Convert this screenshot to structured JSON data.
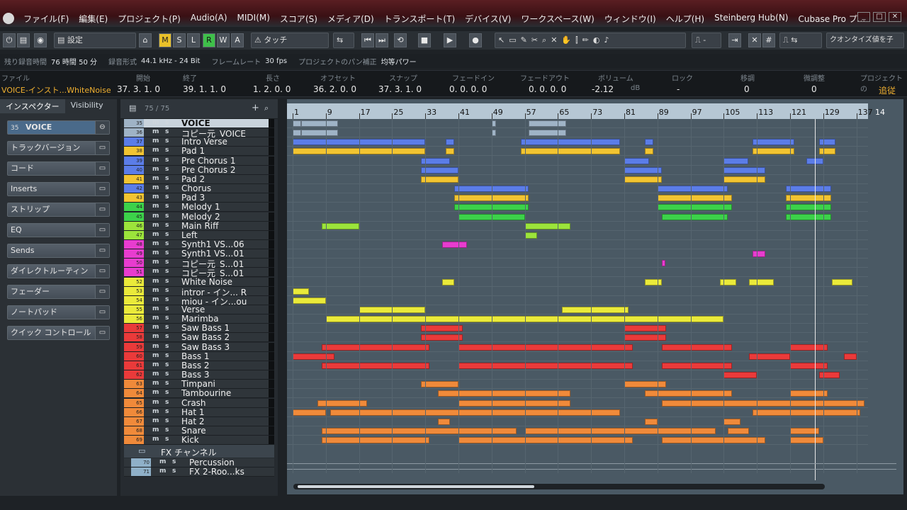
{
  "menubar": {
    "items": [
      "ファイル(F)",
      "編集(E)",
      "プロジェクト(P)",
      "Audio(A)",
      "MIDI(M)",
      "スコア(S)",
      "メディア(D)",
      "トランスポート(T)",
      "デバイス(V)",
      "ワークスペース(W)",
      "ウィンドウ(I)",
      "ヘルプ(H)",
      "Steinberg Hub(N)",
      "Cubase Pro プ..."
    ]
  },
  "toolbar": {
    "setting": "設定",
    "m": "M",
    "s": "S",
    "l": "L",
    "r": "R",
    "w": "W",
    "a": "A",
    "touch": "タッチ",
    "quantize": "クオンタイズ値を子"
  },
  "status": {
    "rec_time_label": "残り録音時間",
    "rec_time_value": "76 時間 50 分",
    "format_label": "録音形式",
    "format_value": "44.1 kHz - 24 Bit",
    "frame_label": "フレームレート",
    "frame_value": "30 fps",
    "pan_label": "プロジェクトのパン補正",
    "pan_value": "均等パワー"
  },
  "infoline": {
    "headers": [
      "ファイル",
      "開始",
      "終了",
      "長さ",
      "オフセット",
      "スナップ",
      "フェードイン",
      "フェードアウト",
      "ボリューム",
      "ロック",
      "移調",
      "微調整",
      "プロジェクトの"
    ],
    "values": [
      "VOICE-インスト...WhiteNoise",
      "37. 3. 1.   0",
      "39. 1. 1.   0",
      "1. 2. 0.   0",
      "36. 2. 0.   0",
      "37. 3. 1.   0",
      "0. 0. 0.   0",
      "0. 0. 0.   0",
      "-2.12",
      "-",
      "0",
      "0",
      "追従"
    ],
    "volume_unit": "dB"
  },
  "inspector": {
    "tabs": [
      "インスペクター",
      "Visibility"
    ],
    "track_number": "35",
    "track_name": "VOICE",
    "sections": [
      "トラックバージョン",
      "コード",
      "Inserts",
      "ストリップ",
      "EQ",
      "Sends",
      "ダイレクトルーティン",
      "フェーダー",
      "ノートパッド",
      "クイック コントロール"
    ]
  },
  "tracklist": {
    "count": "75 / 75",
    "tracks": [
      {
        "num": "35",
        "name": "VOICE",
        "color": "#9fb3c6"
      },
      {
        "num": "36",
        "name": "コピー元_VOICE",
        "color": "#9fb3c6"
      },
      {
        "num": "37",
        "name": "Intro Verse",
        "color": "#5b7de8"
      },
      {
        "num": "38",
        "name": "Pad 1",
        "color": "#f2c431"
      },
      {
        "num": "39",
        "name": "Pre Chorus 1",
        "color": "#5b7de8"
      },
      {
        "num": "40",
        "name": "Pre Chorus 2",
        "color": "#5b7de8"
      },
      {
        "num": "41",
        "name": "Pad 2",
        "color": "#f2c431"
      },
      {
        "num": "42",
        "name": "Chorus",
        "color": "#5b7de8"
      },
      {
        "num": "43",
        "name": "Pad 3",
        "color": "#f2c431"
      },
      {
        "num": "44",
        "name": "Melody 1",
        "color": "#3cd24a"
      },
      {
        "num": "45",
        "name": "Melody 2",
        "color": "#3cd24a"
      },
      {
        "num": "46",
        "name": "Main Riff",
        "color": "#9ce43b"
      },
      {
        "num": "47",
        "name": "Left",
        "color": "#9ce43b"
      },
      {
        "num": "48",
        "name": "Synth1 VS...06",
        "color": "#e83ccf"
      },
      {
        "num": "49",
        "name": "Synth1 VS...01",
        "color": "#e83ccf"
      },
      {
        "num": "50",
        "name": "コピー元_S...01",
        "color": "#e83ccf"
      },
      {
        "num": "51",
        "name": "コピー元_S...01",
        "color": "#e83ccf"
      },
      {
        "num": "52",
        "name": "White Noise",
        "color": "#eaea3a"
      },
      {
        "num": "53",
        "name": "intror - イン... R",
        "color": "#eaea3a"
      },
      {
        "num": "54",
        "name": "miou - イン...ou",
        "color": "#eaea3a"
      },
      {
        "num": "55",
        "name": "Verse",
        "color": "#eaea3a"
      },
      {
        "num": "56",
        "name": "Marimba",
        "color": "#eaea3a"
      },
      {
        "num": "57",
        "name": "Saw Bass 1",
        "color": "#ea3a3a"
      },
      {
        "num": "58",
        "name": "Saw Bass 2",
        "color": "#ea3a3a"
      },
      {
        "num": "59",
        "name": "Saw Bass 3",
        "color": "#ea3a3a"
      },
      {
        "num": "60",
        "name": "Bass 1",
        "color": "#ea3a3a"
      },
      {
        "num": "61",
        "name": "Bass 2",
        "color": "#ea3a3a"
      },
      {
        "num": "62",
        "name": "Bass 3",
        "color": "#ea3a3a"
      },
      {
        "num": "63",
        "name": "Timpani",
        "color": "#f08a3a"
      },
      {
        "num": "64",
        "name": "Tambourine",
        "color": "#f08a3a"
      },
      {
        "num": "65",
        "name": "Crash",
        "color": "#f08a3a"
      },
      {
        "num": "66",
        "name": "Hat 1",
        "color": "#f08a3a"
      },
      {
        "num": "67",
        "name": "Hat 2",
        "color": "#f08a3a"
      },
      {
        "num": "68",
        "name": "Snare",
        "color": "#f08a3a"
      },
      {
        "num": "69",
        "name": "Kick",
        "color": "#f08a3a"
      }
    ],
    "folder": "FX チャンネル",
    "fx_tracks": [
      {
        "num": "70",
        "name": "Percussion"
      },
      {
        "num": "71",
        "name": "FX 2-Roo...ks"
      }
    ],
    "m": "m",
    "s": "s"
  },
  "ruler": {
    "bars": [
      "1",
      "9",
      "17",
      "25",
      "33",
      "41",
      "49",
      "57",
      "65",
      "73",
      "81",
      "89",
      "97",
      "105",
      "113",
      "121",
      "129",
      "137"
    ],
    "overflow": "14"
  },
  "events": [
    [
      [
        1,
        2
      ],
      [
        3,
        9
      ],
      [
        49,
        1
      ],
      [
        58,
        9
      ]
    ],
    [
      [
        1,
        2
      ],
      [
        3,
        9
      ],
      [
        49,
        1
      ],
      [
        58,
        9
      ]
    ],
    [
      [
        1,
        32
      ],
      [
        38,
        2
      ],
      [
        56,
        24
      ],
      [
        86,
        2
      ],
      [
        112,
        10
      ],
      [
        128,
        4
      ]
    ],
    [
      [
        1,
        32
      ],
      [
        38,
        2
      ],
      [
        56,
        24
      ],
      [
        86,
        2
      ],
      [
        112,
        10
      ],
      [
        128,
        4
      ]
    ],
    [
      [
        32,
        7
      ],
      [
        81,
        6
      ],
      [
        105,
        6
      ],
      [
        125,
        4
      ]
    ],
    [
      [
        32,
        9
      ],
      [
        81,
        9
      ],
      [
        105,
        10
      ]
    ],
    [
      [
        32,
        9
      ],
      [
        81,
        9
      ],
      [
        105,
        10
      ]
    ],
    [
      [
        40,
        18
      ],
      [
        89,
        17
      ],
      [
        120,
        11
      ]
    ],
    [
      [
        40,
        18
      ],
      [
        89,
        18
      ],
      [
        120,
        11
      ]
    ],
    [
      [
        40,
        18
      ],
      [
        89,
        18
      ],
      [
        120,
        11
      ]
    ],
    [
      [
        41,
        16
      ],
      [
        90,
        16
      ],
      [
        120,
        11
      ]
    ],
    [
      [
        8,
        9
      ],
      [
        57,
        11
      ]
    ],
    [
      [
        57,
        3
      ]
    ],
    [
      [
        37,
        6
      ]
    ],
    [
      [
        112,
        3
      ]
    ],
    [
      [
        90,
        1
      ]
    ],
    [],
    [
      [
        37,
        3
      ],
      [
        86,
        4
      ],
      [
        104,
        4
      ],
      [
        111,
        6
      ],
      [
        131,
        5
      ]
    ],
    [
      [
        1,
        4
      ]
    ],
    [
      [
        1,
        8
      ]
    ],
    [
      [
        17,
        16
      ],
      [
        66,
        16
      ]
    ],
    [
      [
        9,
        96
      ]
    ],
    [
      [
        32,
        10
      ],
      [
        81,
        10
      ]
    ],
    [
      [
        32,
        10
      ],
      [
        81,
        10
      ]
    ],
    [
      [
        8,
        26
      ],
      [
        41,
        42
      ],
      [
        90,
        17
      ],
      [
        121,
        9
      ]
    ],
    [
      [
        1,
        10
      ],
      [
        111,
        10
      ],
      [
        134,
        3
      ]
    ],
    [
      [
        8,
        26
      ],
      [
        41,
        42
      ],
      [
        90,
        17
      ],
      [
        121,
        9
      ]
    ],
    [
      [
        105,
        8
      ],
      [
        128,
        5
      ]
    ],
    [
      [
        32,
        9
      ],
      [
        81,
        10
      ]
    ],
    [
      [
        36,
        32
      ],
      [
        86,
        21
      ],
      [
        121,
        9
      ]
    ],
    [
      [
        7,
        12
      ],
      [
        41,
        27
      ],
      [
        90,
        49
      ]
    ],
    [
      [
        1,
        8
      ],
      [
        10,
        70
      ],
      [
        112,
        26
      ]
    ],
    [
      [
        36,
        3
      ],
      [
        86,
        3
      ],
      [
        105,
        4
      ]
    ],
    [
      [
        8,
        47
      ],
      [
        57,
        46
      ],
      [
        106,
        5
      ],
      [
        121,
        7
      ]
    ],
    [
      [
        8,
        26
      ],
      [
        41,
        42
      ],
      [
        90,
        25
      ],
      [
        121,
        8
      ]
    ]
  ]
}
